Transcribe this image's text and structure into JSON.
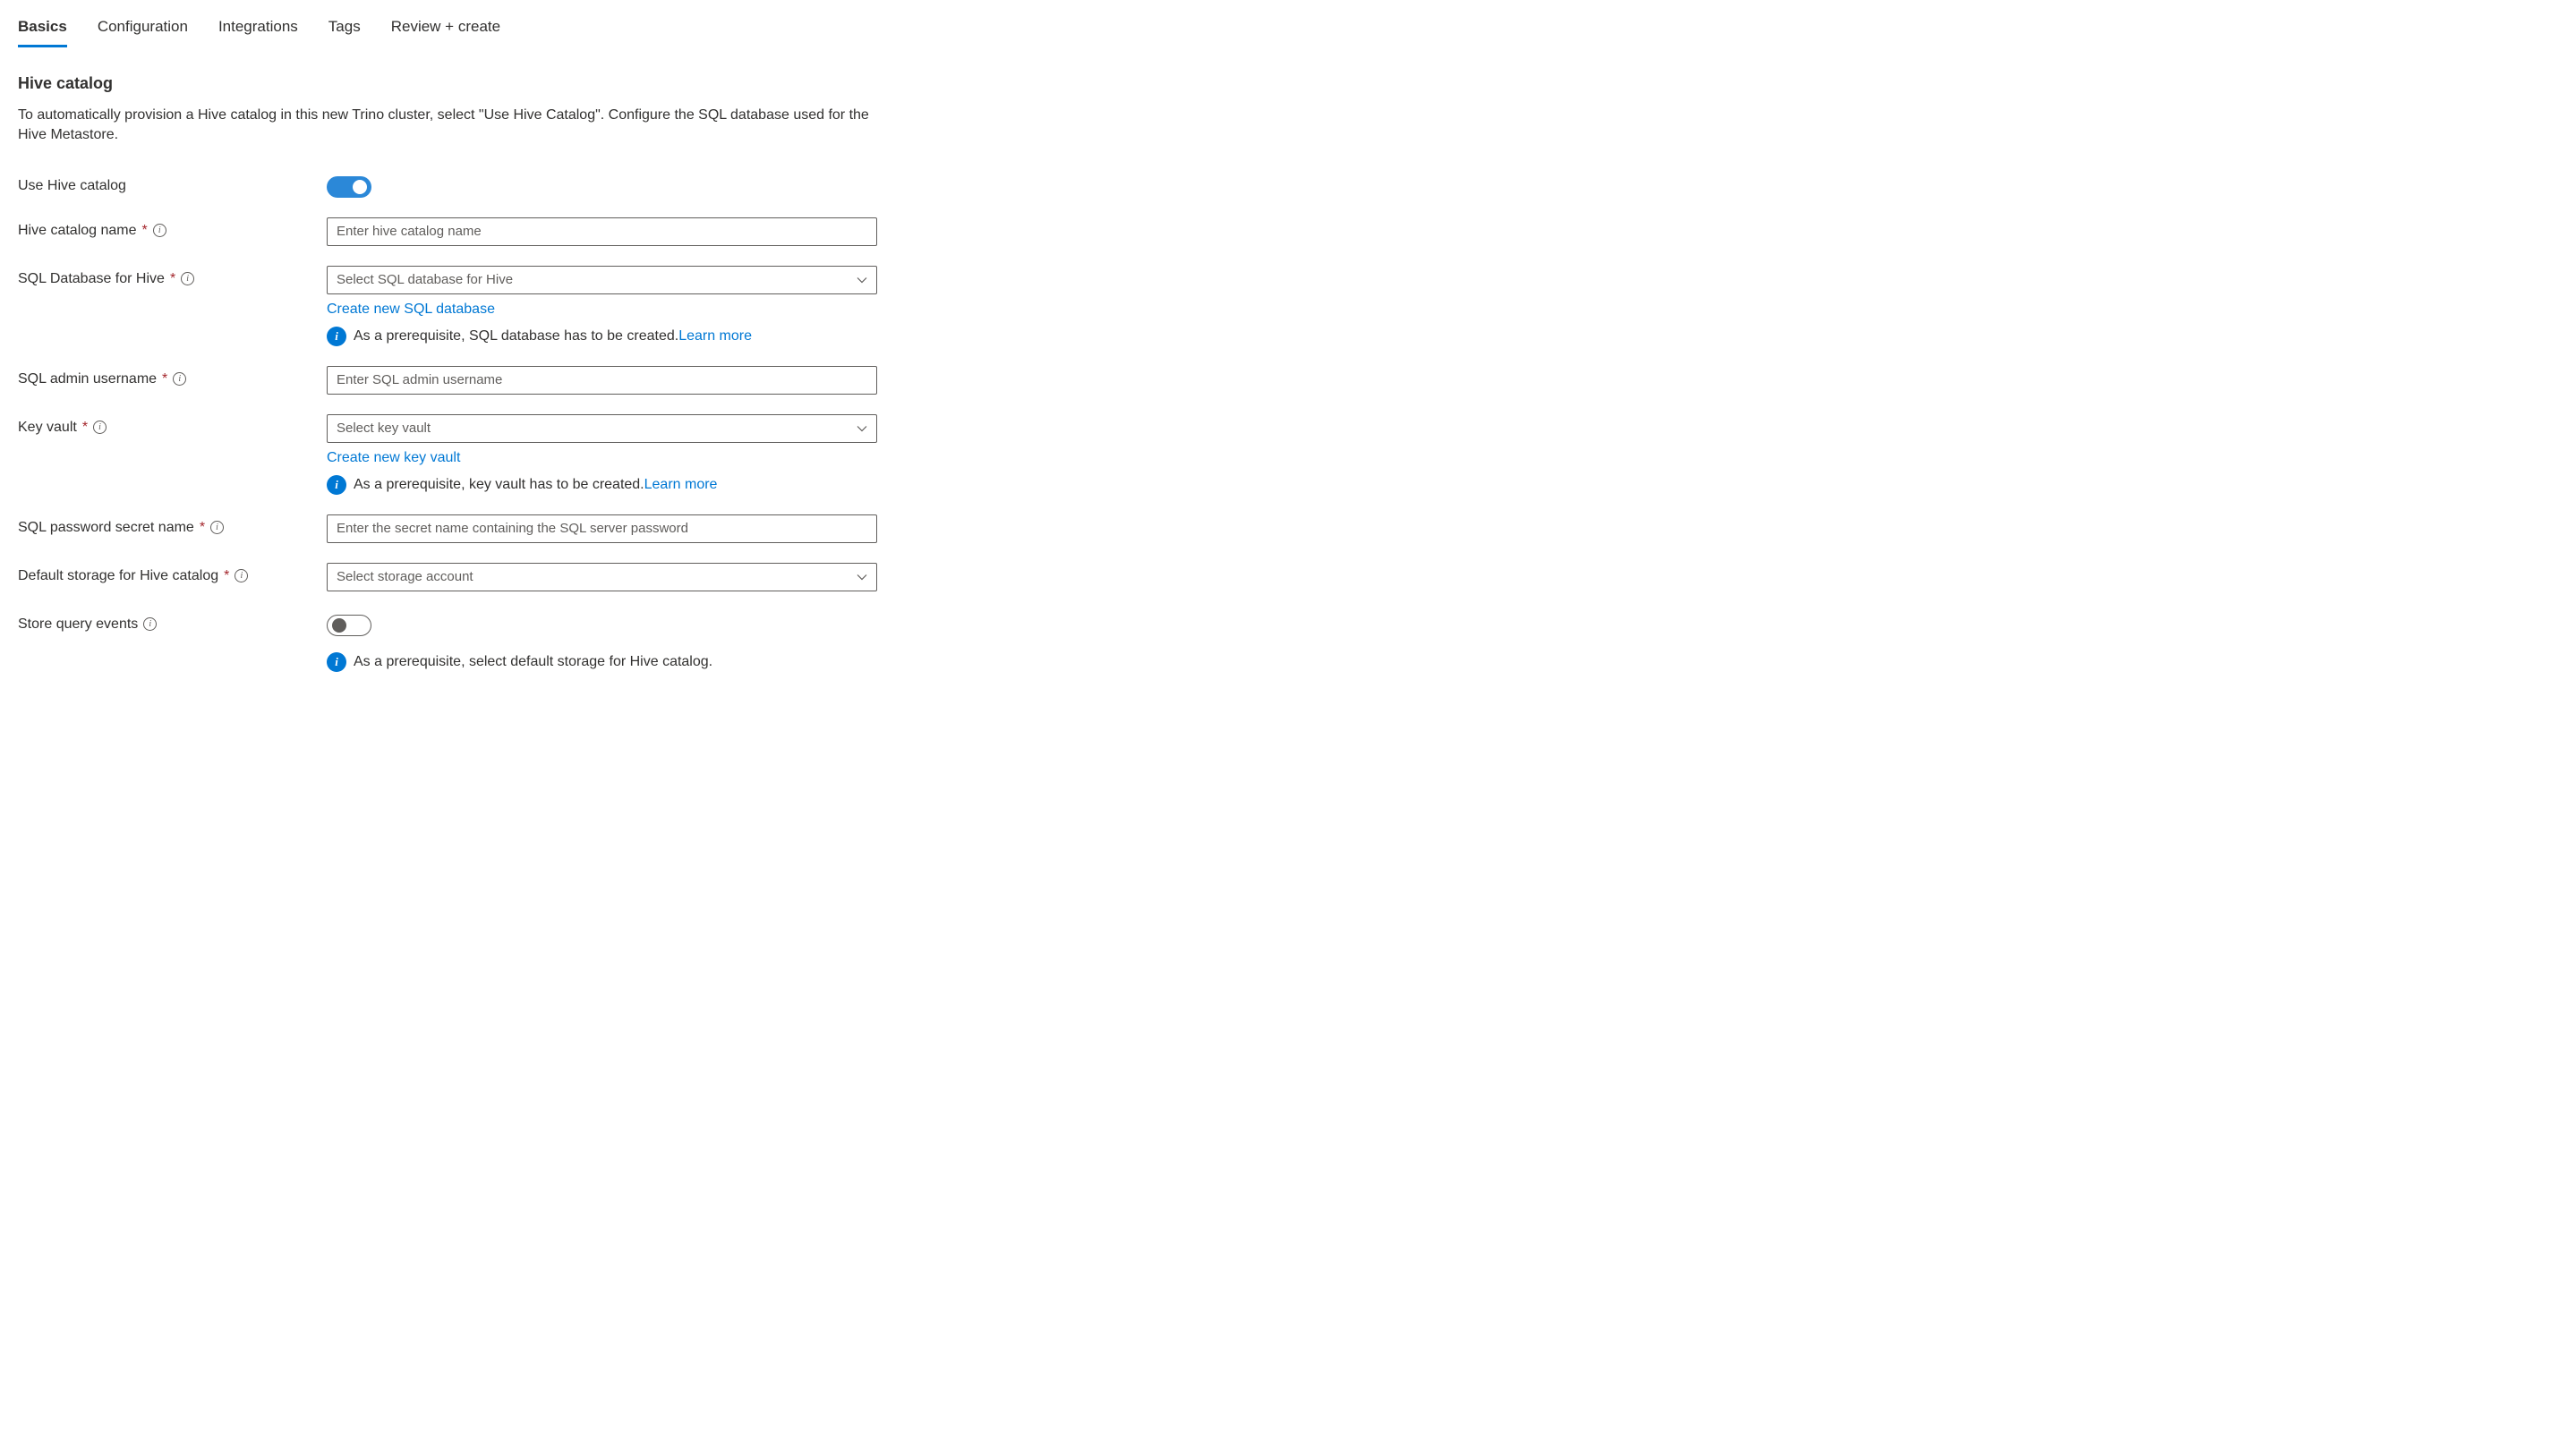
{
  "tabs": {
    "basics": "Basics",
    "configuration": "Configuration",
    "integrations": "Integrations",
    "tags": "Tags",
    "review": "Review + create"
  },
  "section": {
    "title": "Hive catalog",
    "description": "To automatically provision a Hive catalog in this new Trino cluster, select \"Use Hive Catalog\". Configure the SQL database used for the Hive Metastore."
  },
  "fields": {
    "useHiveCatalog": {
      "label": "Use Hive catalog"
    },
    "catalogName": {
      "label": "Hive catalog name",
      "placeholder": "Enter hive catalog name"
    },
    "sqlDatabase": {
      "label": "SQL Database for Hive",
      "placeholder": "Select SQL database for Hive",
      "createLink": "Create new SQL database",
      "infoText": "As a prerequisite, SQL database has to be created.",
      "learnMore": "Learn more"
    },
    "sqlAdminUser": {
      "label": "SQL admin username",
      "placeholder": "Enter SQL admin username"
    },
    "keyVault": {
      "label": "Key vault",
      "placeholder": "Select key vault",
      "createLink": "Create new key vault",
      "infoText": "As a prerequisite, key vault has to be created.",
      "learnMore": "Learn more"
    },
    "sqlPasswordSecret": {
      "label": "SQL password secret name",
      "placeholder": "Enter the secret name containing the SQL server password"
    },
    "defaultStorage": {
      "label": "Default storage for Hive catalog",
      "placeholder": "Select storage account"
    },
    "storeQueryEvents": {
      "label": "Store query events",
      "infoText": "As a prerequisite, select default storage for Hive catalog."
    }
  }
}
